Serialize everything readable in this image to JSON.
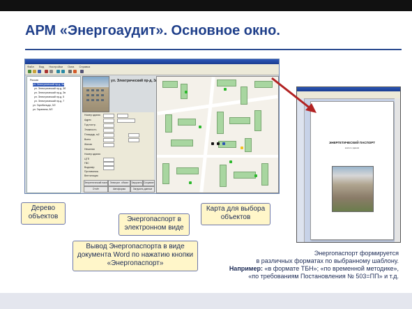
{
  "title": "АРМ «Энергоаудит». Основное окно.",
  "app": {
    "menu": [
      "Файл",
      "Вид",
      "Настройки",
      "Окна",
      "Справка"
    ],
    "tree": [
      {
        "label": "Россия",
        "selected": false
      },
      {
        "label": "ул. Электрический пр-д, 3а",
        "selected": true
      },
      {
        "label": "ул. Электрический пр-д, 3б",
        "selected": false
      },
      {
        "label": "ул. Электрический пр-д, 3в",
        "selected": false
      },
      {
        "label": "ул. Электрический пр-д, 5",
        "selected": false
      },
      {
        "label": "ул. Электрический пр-д, 7",
        "selected": false
      },
      {
        "label": "ул. Гарибальди, 3/2",
        "selected": false
      },
      {
        "label": "ул. Гаранина, 8/2",
        "selected": false
      }
    ],
    "address": "ул. Электрический пр-д, 3а",
    "form_fields": [
      "Номер здания",
      "Адрес",
      "Год постр.",
      "Этажность",
      "Площадь, м2",
      "Всего",
      "Жилая",
      "Нежилая",
      "Номер здания",
      "ЦТП",
      "ГВС",
      "Водомер",
      "Противопож.",
      "Вентиляция"
    ],
    "buttons": [
      "Энергетический паспорт",
      "Электрон. объект",
      "Загрузить",
      "Сохранить"
    ],
    "buttons_row2": [
      "Отчёт",
      "Автоформа",
      "Загрузить данные"
    ]
  },
  "document": {
    "heading": "ЭНЕРГЕТИЧЕСКИЙ ПАСПОРТ",
    "subheading": "жилого здания"
  },
  "callouts": {
    "tree": "Дерево объектов",
    "passport_electronic": "Энергопаспорт в электронном виде",
    "map": "Карта для выбора объектов",
    "word_output": "Вывод Энергопаспорта в виде документа Word по нажатию кнопки «Энергопаспорт»"
  },
  "note": {
    "line1": "Энергопаспорт формируется",
    "line2": "в различных форматах по выбранному шаблону.",
    "line3_bold": "Например:",
    "line3": "«в формате ТБН»; «по временной методике»,",
    "line4": "«по требованиям Постановления № 503=ПП» и т.д."
  },
  "colors": {
    "title": "#1f3f8a",
    "callout_bg": "#fff6c9",
    "arrow": "#b22222",
    "map_building": "#a8d6a0"
  }
}
